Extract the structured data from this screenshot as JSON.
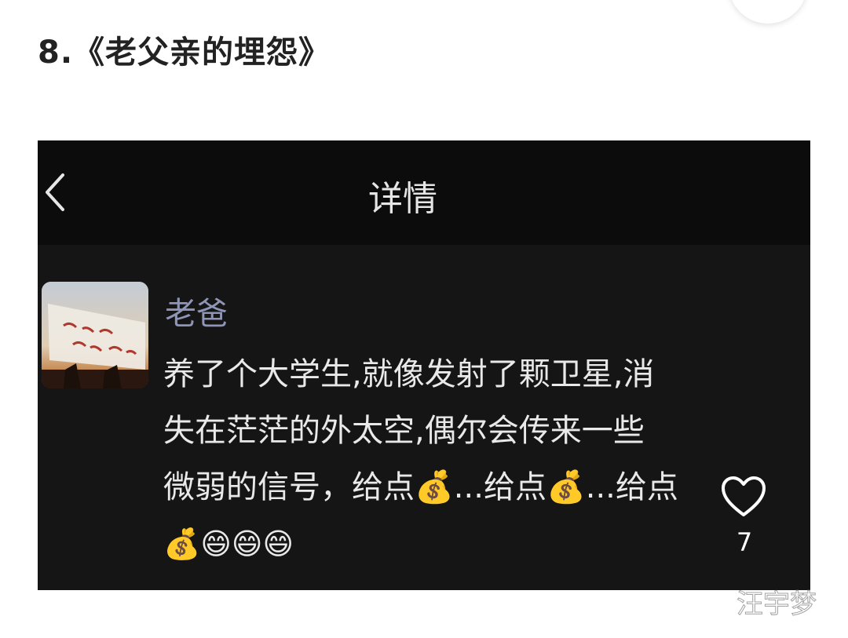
{
  "article": {
    "title": "8.《老父亲的埋怨》"
  },
  "screenshot": {
    "nav": {
      "back_icon": "chevron-left-icon",
      "title": "详情"
    },
    "post": {
      "sender_name": "老爸",
      "message_lines": [
        "养了个大学生,就像发射了颗卫星,消",
        "失在茫茫的外太空,偶尔会传来一些",
        "微弱的信号，给点💰...给点💰...给点",
        "💰😄😄😄"
      ]
    }
  },
  "like": {
    "icon": "heart-icon",
    "count": "7"
  },
  "watermark": "汪宇梦",
  "colors": {
    "screenshot_bg": "#151515",
    "nav_bg": "#0c0c0c",
    "sender_name": "#8e95b6",
    "message_text": "#e9e9e9"
  }
}
